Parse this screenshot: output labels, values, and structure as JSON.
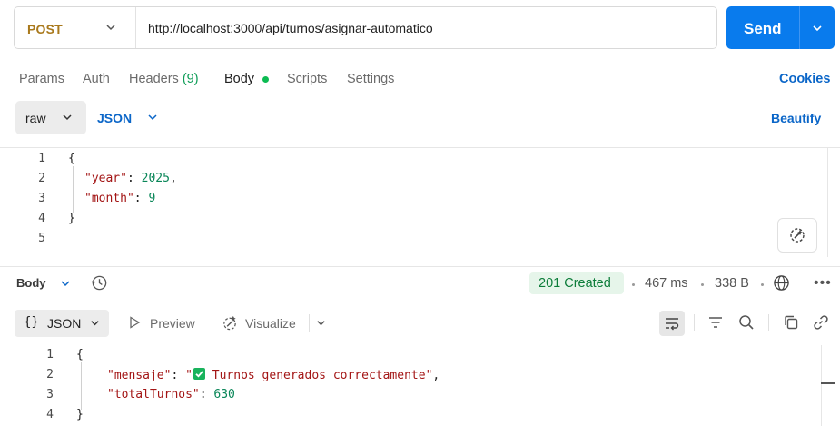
{
  "request": {
    "method": "POST",
    "url": "http://localhost:3000/api/turnos/asignar-automatico",
    "send_label": "Send"
  },
  "request_tabs": {
    "params": "Params",
    "auth": "Auth",
    "headers": "Headers",
    "headers_count": "(9)",
    "body": "Body",
    "scripts": "Scripts",
    "settings": "Settings",
    "cookies": "Cookies",
    "active": "Body"
  },
  "body_mode": {
    "mode": "raw",
    "language": "JSON",
    "beautify": "Beautify"
  },
  "request_editor": {
    "line_numbers": [
      "1",
      "2",
      "3",
      "4",
      "5"
    ],
    "open_brace": "{",
    "close_brace": "}",
    "key_year": "\"year\"",
    "val_year": "2025",
    "key_month": "\"month\"",
    "val_month": "9"
  },
  "response": {
    "body_label": "Body",
    "status": "201 Created",
    "time": "467 ms",
    "size": "338 B",
    "format": "JSON",
    "format_brace": "{}",
    "preview": "Preview",
    "visualize": "Visualize",
    "line_numbers": [
      "1",
      "2",
      "3",
      "4"
    ],
    "open_brace": "{",
    "close_brace": "}",
    "key_mensaje": "\"mensaje\"",
    "val_mensaje_open": "\"",
    "val_mensaje_text": " Turnos generados correctamente\"",
    "key_total": "\"totalTurnos\"",
    "val_total": "630",
    "more": "•••"
  },
  "colors": {
    "accent": "#097bed",
    "method": "#a9791c",
    "status_ok": "#0d7d3a",
    "tab_indicator": "#ff6c37"
  }
}
